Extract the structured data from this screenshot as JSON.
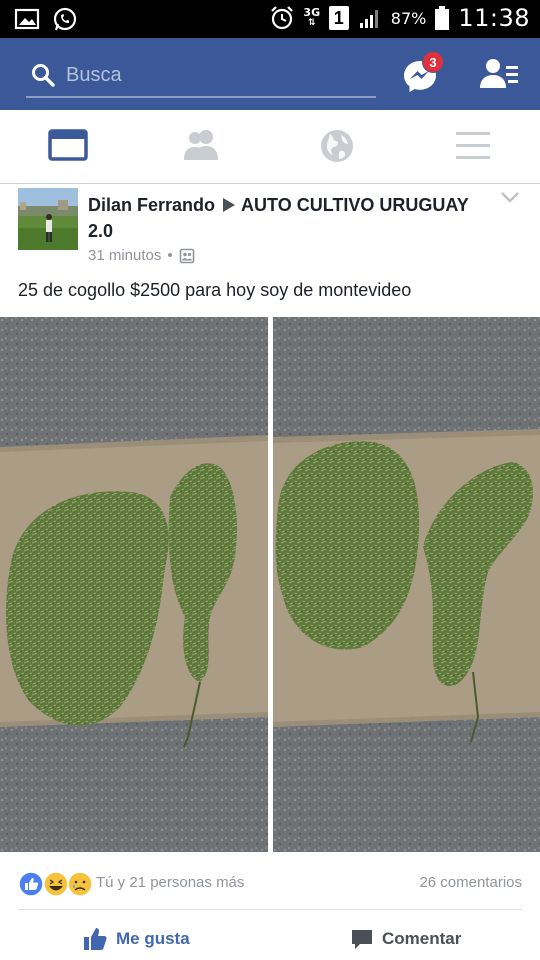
{
  "status_bar": {
    "network": "3G",
    "sim": "1",
    "battery": "87%",
    "time": "11:38"
  },
  "header": {
    "search_placeholder": "Busca",
    "messenger_badge": "3"
  },
  "tabs": [
    {
      "name": "news-feed",
      "active": true
    },
    {
      "name": "friend-requests",
      "active": false
    },
    {
      "name": "notifications",
      "active": false
    },
    {
      "name": "menu",
      "active": false
    }
  ],
  "post": {
    "author": "Dilan Ferrando",
    "group": "AUTO CULTIVO URUGUAY 2.0",
    "time": "31 minutos",
    "separator": "•",
    "text": "25 de cogollo $2500 para hoy soy de montevideo",
    "reactions_text": "Tú y 21 personas más",
    "comments_count": "26 comentarios",
    "like_label": "Me gusta",
    "comment_label": "Comentar"
  },
  "colors": {
    "brand_blue": "#3b5998",
    "like_blue": "#4267b2",
    "badge_red": "#e0303c"
  }
}
